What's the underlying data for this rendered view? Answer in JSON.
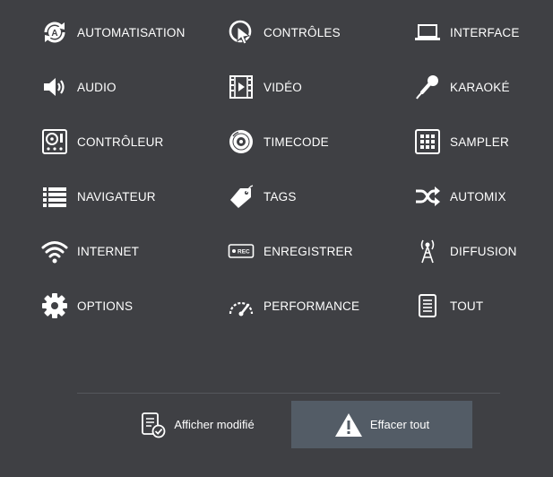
{
  "menu": {
    "items": [
      {
        "label": "AUTOMATISATION",
        "icon": "automation-icon"
      },
      {
        "label": "CONTRÔLES",
        "icon": "controls-icon"
      },
      {
        "label": "INTERFACE",
        "icon": "laptop-icon"
      },
      {
        "label": "AUDIO",
        "icon": "speaker-icon"
      },
      {
        "label": "VIDÉO",
        "icon": "film-icon"
      },
      {
        "label": "KARAOKÉ",
        "icon": "microphone-icon"
      },
      {
        "label": "CONTRÔLEUR",
        "icon": "dj-controller-icon"
      },
      {
        "label": "TIMECODE",
        "icon": "vinyl-icon"
      },
      {
        "label": "SAMPLER",
        "icon": "sampler-grid-icon"
      },
      {
        "label": "NAVIGATEUR",
        "icon": "list-icon"
      },
      {
        "label": "TAGS",
        "icon": "tag-icon"
      },
      {
        "label": "AUTOMIX",
        "icon": "shuffle-icon"
      },
      {
        "label": "INTERNET",
        "icon": "wifi-icon"
      },
      {
        "label": "ENREGISTRER",
        "icon": "rec-icon"
      },
      {
        "label": "DIFFUSION",
        "icon": "broadcast-tower-icon"
      },
      {
        "label": "OPTIONS",
        "icon": "gear-icon"
      },
      {
        "label": "PERFORMANCE",
        "icon": "gauge-icon"
      },
      {
        "label": "TOUT",
        "icon": "document-icon"
      }
    ]
  },
  "footer": {
    "show_modified_label": "Afficher modifié",
    "clear_all_label": "Effacer tout"
  },
  "colors": {
    "background": "#3f4044",
    "clear_button_bg": "#535c66",
    "text": "#ffffff"
  }
}
